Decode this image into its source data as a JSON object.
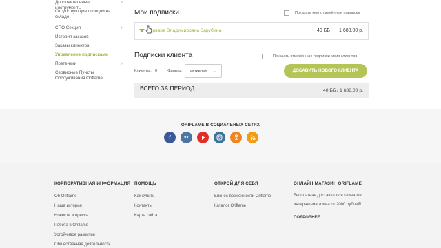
{
  "sidebar": {
    "items": [
      {
        "label": "Дополнительные инструменты",
        "chevron": true,
        "active": false
      },
      {
        "label": "Отсутствующие позиции на складе",
        "chevron": false,
        "active": false
      },
      {
        "label": "СПО Секция",
        "chevron": true,
        "active": false
      },
      {
        "label": "История заказов",
        "chevron": false,
        "active": false
      },
      {
        "label": "Заказы клиентов",
        "chevron": false,
        "active": false
      },
      {
        "label": "Управление подписками",
        "chevron": false,
        "active": true
      },
      {
        "label": "Претензии",
        "chevron": true,
        "active": false
      },
      {
        "label": "Сервисные Пункты Обслуживания Oriflame",
        "chevron": false,
        "active": false
      }
    ]
  },
  "my_subs": {
    "title": "Мои подписки",
    "show_cancelled_label": "Показать мои отменённые подписки",
    "row": {
      "name": "Варвара Владимировна Зарубина",
      "bb": "40 ББ",
      "amount": "1 688.00 р."
    }
  },
  "client_subs": {
    "title": "Подписки клиента",
    "show_cancelled_label": "Показать отменённые подписки моих клиентов",
    "clients_label": "Клиенты:",
    "clients_count": "0",
    "filter_label": "Фильтр:",
    "filter_value": "активные",
    "add_button": "ДОБАВИТЬ НОВОГО КЛИЕНТА"
  },
  "total": {
    "label": "ВСЕГО ЗА ПЕРИОД",
    "value": "40 ББ / 1 688.00 р."
  },
  "social": {
    "title": "ORIFLAME В СОЦИАЛЬНЫХ СЕТЯХ",
    "icons": [
      "facebook-icon",
      "vk-icon",
      "youtube-icon",
      "instagram-icon",
      "odnoklassniki-icon",
      "rss-icon"
    ]
  },
  "footer": {
    "corp": {
      "title": "КОРПОРАТИВНАЯ ИНФОРМАЦИЯ",
      "links": [
        "Об Oriflame",
        "Наша история",
        "Новости и пресса",
        "Работа в Oriflame",
        "Устойчивое развитие",
        "Общественная деятельность"
      ]
    },
    "help": {
      "title": "ПОМОЩЬ",
      "links": [
        "Как купить",
        "Контакты",
        "Карта сайта"
      ]
    },
    "discover": {
      "title": "ОТКРОЙ ДЛЯ СЕБЯ",
      "links": [
        "Бизнес-возможности Oriflame",
        "Каталог Oriflame"
      ]
    },
    "shop": {
      "title": "ОНЛАЙН МАГАЗИН ORIFLAME",
      "lines": [
        "Бесплатная доставка для клиентов",
        "интернет-магазина от 2000 рублей!"
      ],
      "more": "ПОДРОБНЕЕ"
    }
  },
  "colors": {
    "accent": "#9bb53c",
    "button": "#b4c455"
  }
}
